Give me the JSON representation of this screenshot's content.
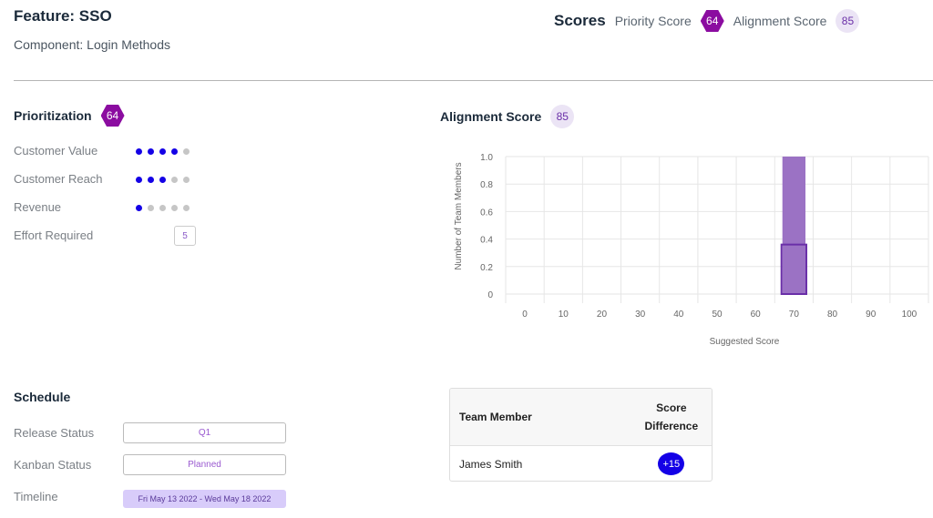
{
  "header": {
    "title": "Feature: SSO",
    "subtitle": "Component: Login Methods",
    "scores_label": "Scores",
    "priority_label": "Priority Score",
    "priority_value": "64",
    "alignment_label": "Alignment Score",
    "alignment_value": "85"
  },
  "prioritization": {
    "title": "Prioritization",
    "score": "64",
    "rows": [
      {
        "label": "Customer Value",
        "filled": 4,
        "total": 5
      },
      {
        "label": "Customer Reach",
        "filled": 3,
        "total": 5
      },
      {
        "label": "Revenue",
        "filled": 1,
        "total": 5
      }
    ],
    "effort_label": "Effort Required",
    "effort_value": "5"
  },
  "alignment": {
    "title": "Alignment Score",
    "score": "85"
  },
  "chart_data": {
    "type": "bar",
    "title": "",
    "xlabel": "Suggested Score",
    "ylabel": "Number of Team Members",
    "x_ticks": [
      "0",
      "10",
      "20",
      "30",
      "40",
      "50",
      "60",
      "70",
      "80",
      "90",
      "100"
    ],
    "y_ticks": [
      "0",
      "0.2",
      "0.4",
      "0.6",
      "0.8",
      "1.0"
    ],
    "xlim": [
      -5,
      105
    ],
    "ylim": [
      0,
      1
    ],
    "grid": true,
    "bars": [
      {
        "x": 70,
        "value": 1
      }
    ],
    "bar_color": "#9b72c4"
  },
  "schedule": {
    "title": "Schedule",
    "release_label": "Release Status",
    "release_value": "Q1",
    "kanban_label": "Kanban Status",
    "kanban_value": "Planned",
    "timeline_label": "Timeline",
    "timeline_value": "Fri May 13 2022 - Wed May 18 2022"
  },
  "team_table": {
    "headers": [
      "Team Member",
      "Score",
      "Difference"
    ],
    "rows": [
      {
        "member": "James Smith",
        "difference": "+15"
      }
    ]
  }
}
